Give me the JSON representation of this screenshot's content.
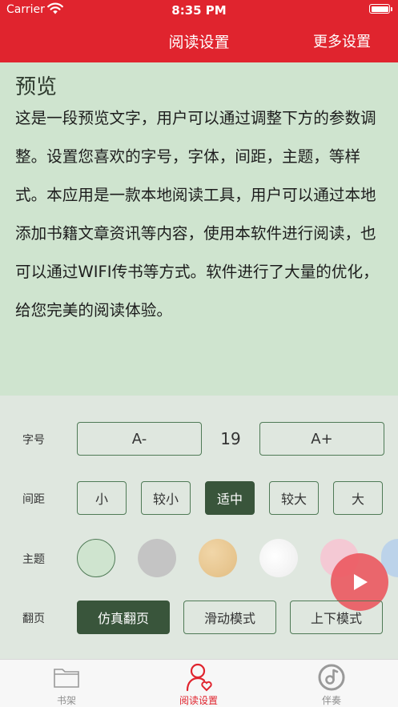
{
  "status_bar": {
    "carrier": "Carrier",
    "time": "8:35 PM"
  },
  "nav": {
    "title": "阅读设置",
    "more": "更多设置"
  },
  "preview": {
    "heading": "预览",
    "text": "这是一段预览文字，用户可以通过调整下方的参数调整。设置您喜欢的字号，字体，间距，主题，等样式。本应用是一款本地阅读工具，用户可以通过本地添加书籍文章资讯等内容，使用本软件进行阅读，也可以通过WIFI传书等方式。软件进行了大量的优化，给您完美的阅读体验。"
  },
  "settings": {
    "font_size": {
      "label": "字号",
      "decrease": "A-",
      "value": "19",
      "increase": "A+"
    },
    "spacing": {
      "label": "间距",
      "options": [
        "小",
        "较小",
        "适中",
        "较大",
        "大"
      ],
      "selected": "适中"
    },
    "theme": {
      "label": "主题",
      "swatches": [
        {
          "name": "light-green",
          "color": "#cfe4cf",
          "selected": true
        },
        {
          "name": "gray",
          "color": "#c4c4c4",
          "selected": false
        },
        {
          "name": "paper-tan",
          "color": "#e9c893",
          "selected": false
        },
        {
          "name": "white-marble",
          "color": "#f4f4f4",
          "selected": false
        },
        {
          "name": "pink",
          "color": "#f4c9d4",
          "selected": false
        },
        {
          "name": "light-blue",
          "color": "#bcd3ea",
          "selected": false
        }
      ]
    },
    "page_turn": {
      "label": "翻页",
      "options": [
        "仿真翻页",
        "滑动模式",
        "上下模式"
      ],
      "selected": "仿真翻页"
    }
  },
  "tabs": [
    {
      "label": "书架",
      "icon": "folder-icon",
      "active": false
    },
    {
      "label": "阅读设置",
      "icon": "user-heart-icon",
      "active": true
    },
    {
      "label": "伴奏",
      "icon": "music-disc-icon",
      "active": false
    }
  ],
  "colors": {
    "accent_red": "#e0242e",
    "selected_green": "#39553b",
    "border_green": "#4f7a56",
    "preview_bg": "#cfe4cf"
  }
}
